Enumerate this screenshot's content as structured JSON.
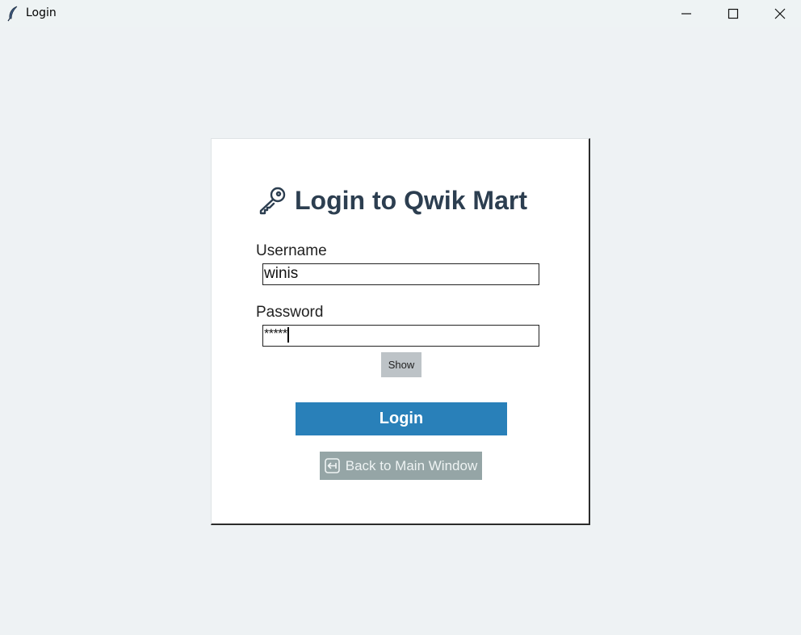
{
  "window": {
    "title": "Login",
    "app_icon": "feather-icon",
    "controls": [
      "minimize-icon",
      "maximize-icon",
      "close-icon"
    ]
  },
  "login_form": {
    "heading_icon": "key-icon",
    "heading": "Login to Qwik Mart",
    "username": {
      "label": "Username",
      "value": "winis"
    },
    "password": {
      "label": "Password",
      "value": "*****"
    },
    "show_button_label": "Show",
    "login_button_label": "Login",
    "back_button": {
      "icon": "back-arrow-icon",
      "label": "Back to Main Window"
    }
  },
  "colors": {
    "background": "#eef2f4",
    "heading": "#2c3e50",
    "login_button": "#2980b9",
    "back_button": "#95a5a6",
    "show_button": "#bdc3c7"
  }
}
